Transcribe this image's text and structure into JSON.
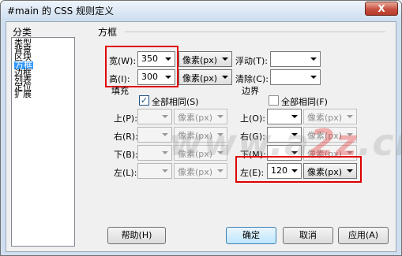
{
  "window": {
    "title": "#main 的 CSS 规则定义",
    "close_label": "X"
  },
  "category": {
    "header": "分类",
    "items": [
      "类型",
      "背景",
      "区块",
      "方框",
      "边框",
      "列表",
      "定位",
      "扩展"
    ],
    "selected": "方框"
  },
  "panel": {
    "title": "方框"
  },
  "size": {
    "width": {
      "label": "宽(W):",
      "value": "350",
      "unit": "像素(px)"
    },
    "height": {
      "label": "高(I):",
      "value": "300",
      "unit": "像素(px)"
    },
    "float": {
      "label": "浮动(T):",
      "value": ""
    },
    "clear": {
      "label": "清除(C):",
      "value": ""
    }
  },
  "padding": {
    "title": "填充",
    "same_label": "全部相同(S)",
    "same_checked": true,
    "top": {
      "label": "上(P):",
      "value": "",
      "unit": "像素(px)"
    },
    "right": {
      "label": "右(R):",
      "value": "",
      "unit": "像素(px)"
    },
    "bottom": {
      "label": "下(B):",
      "value": "",
      "unit": "像素(px)"
    },
    "left": {
      "label": "左(L):",
      "value": "",
      "unit": "像素(px)"
    }
  },
  "margin": {
    "title": "边界",
    "same_label": "全部相同(F)",
    "same_checked": false,
    "top": {
      "label": "上(O):",
      "value": "",
      "unit": "像素(px)"
    },
    "right": {
      "label": "右(G):",
      "value": "",
      "unit": "像素(px)"
    },
    "bottom": {
      "label": "下(M):",
      "value": "",
      "unit": "像素(px)"
    },
    "left": {
      "label": "左(E):",
      "value": "120",
      "unit": "像素(px)"
    }
  },
  "watermark": {
    "text_a": "www.a",
    "text_b": "2z",
    "text_c": ".cn"
  },
  "buttons": {
    "help": "帮助(H)",
    "ok": "确定",
    "cancel": "取消",
    "apply": "应用(A)"
  },
  "colors": {
    "highlight": "#e00000",
    "selection": "#3399ff"
  }
}
